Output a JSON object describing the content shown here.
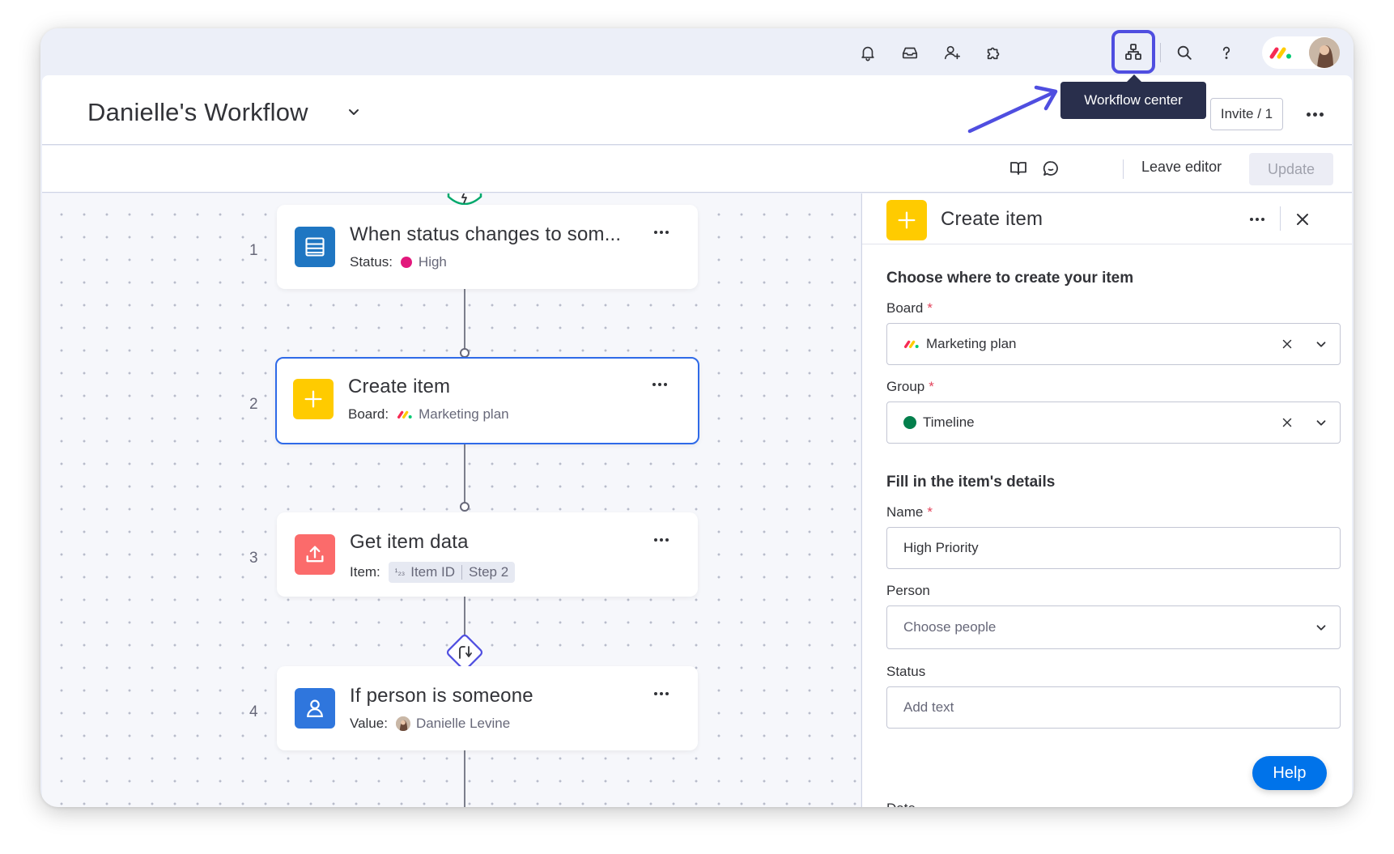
{
  "topbar": {
    "icons": [
      "bell-icon",
      "inbox-icon",
      "invite-members-icon",
      "apps-icon",
      "workflow-center-icon",
      "search-icon",
      "help-icon"
    ],
    "tooltip": "Workflow center"
  },
  "header": {
    "title": "Danielle's Workflow",
    "invite_label": "Invite / 1"
  },
  "subtoolbar": {
    "leave_editor": "Leave editor",
    "update": "Update"
  },
  "steps": [
    {
      "number": "1",
      "title": "When status changes to som...",
      "meta_label": "Status:",
      "meta_value": "High",
      "icon": "board-icon",
      "status_color": "#e2187c"
    },
    {
      "number": "2",
      "title": "Create item",
      "meta_label": "Board:",
      "meta_value": "Marketing plan",
      "icon": "plus-icon"
    },
    {
      "number": "3",
      "title": "Get item data",
      "meta_label": "Item:",
      "chip_prefix": "¹₂₃",
      "chip_value": "Item ID",
      "chip_step": "Step 2",
      "icon": "upload-icon"
    },
    {
      "number": "4",
      "title": "If person is someone",
      "meta_label": "Value:",
      "meta_value": "Danielle Levine",
      "icon": "person-icon"
    }
  ],
  "panel": {
    "title": "Create item",
    "section1": "Choose where to create your item",
    "board_label": "Board",
    "board_value": "Marketing plan",
    "group_label": "Group",
    "group_value": "Timeline",
    "section2": "Fill in the item's details",
    "name_label": "Name",
    "name_value": "High Priority",
    "person_label": "Person",
    "person_placeholder": "Choose people",
    "status_label": "Status",
    "status_placeholder": "Add text",
    "date_label": "Date",
    "required_mark": "*"
  },
  "help": "Help",
  "colors": {
    "accent": "#0073ea",
    "selected_border": "#2f6ae8",
    "highlight": "#4f4ee0",
    "trigger_icon": "#1f76c2",
    "create_icon": "#ffcb00",
    "data_icon": "#fb6b6b",
    "condition_icon": "#2f76dd",
    "group_color": "#037f4c",
    "tooltip_bg": "#292f4c"
  }
}
